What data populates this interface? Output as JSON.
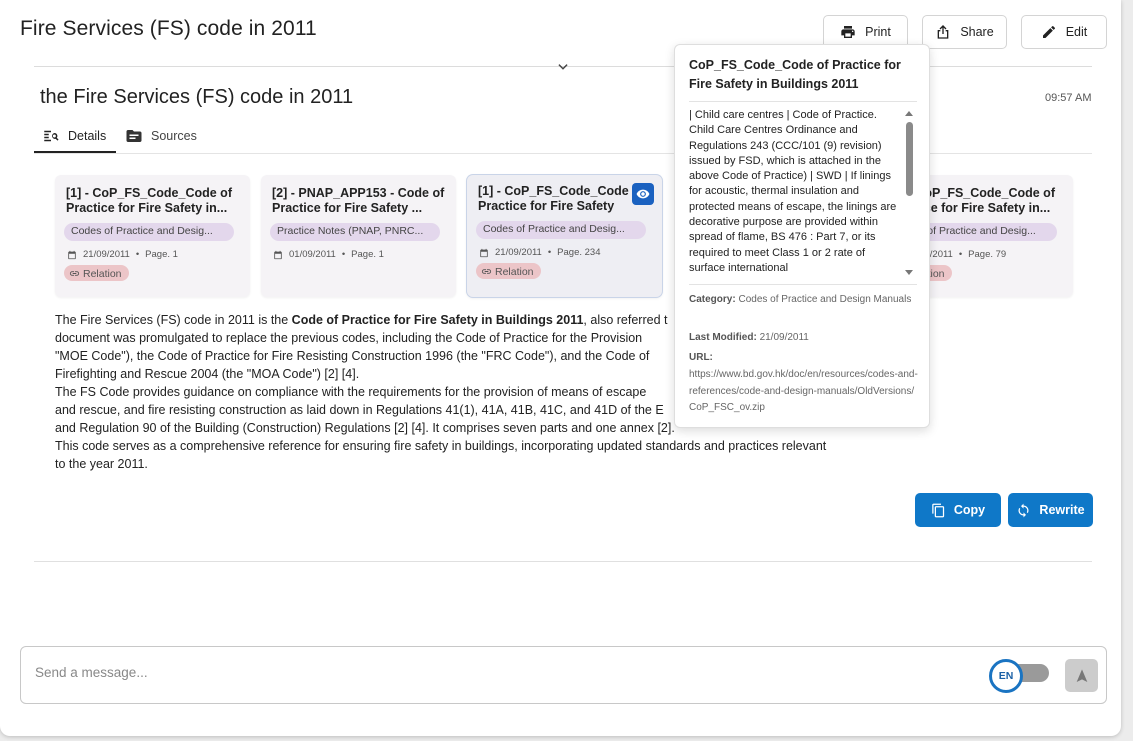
{
  "page_title": "Fire Services (FS) code in 2011",
  "header_buttons": {
    "print": "Print",
    "share": "Share",
    "edit": "Edit"
  },
  "answer": {
    "title": "the Fire Services (FS) code in 2011",
    "time": "09:57 AM",
    "tabs": [
      {
        "label": "Details",
        "icon": "details-search-icon"
      },
      {
        "label": "Sources",
        "icon": "folder-icon"
      }
    ]
  },
  "sources": [
    {
      "title": "[1] - CoP_FS_Code_Code of Practice for Fire Safety in...",
      "category": "Codes of Practice and Desig...",
      "date": "21/09/2011",
      "page": "Page. 1",
      "relation": "Relation"
    },
    {
      "title": "[2] - PNAP_APP153 - Code of Practice for Fire Safety ...",
      "category": "Practice Notes (PNAP, PNRC...",
      "date": "01/09/2011",
      "page": "Page. 1",
      "relation": ""
    },
    {
      "title": "[1] - CoP_FS_Code_Code Practice for Fire Safety in...",
      "category": "Codes of Practice and Desig...",
      "date": "21/09/2011",
      "page": "Page. 234",
      "relation": "Relation"
    },
    {
      "title": "[1] - CoP_FS_Code_Code of Practice for Fire Safety in...",
      "category": "Codes of Practice and Desig...",
      "date": "21/09/2011",
      "page": "Page. 79",
      "relation": "Relation"
    }
  ],
  "body": {
    "p1_a": "The Fire Services (FS) code in 2011 is the ",
    "p1_bold": "Code of Practice for Fire Safety in Buildings 2011",
    "p1_b": ", also referred t\ndocument was promulgated to replace the previous codes, including the Code of Practice for the Provision\n\"MOE Code\"), the Code of Practice for Fire Resisting Construction 1996 (the \"FRC Code\"), and the Code of\nFirefighting and Rescue 2004 (the \"MOA Code\") [2] [4].",
    "p2": "The FS Code provides guidance on compliance with the requirements for the provision of means of escape\nand rescue, and fire resisting construction as laid down in Regulations 41(1), 41A, 41B, 41C, and 41D of the E\nand Regulation 90 of the Building (Construction) Regulations [2] [4]. It comprises seven parts and one annex [2].",
    "p3": "This code serves as a comprehensive reference for ensuring fire safety in buildings, incorporating updated standards and practices relevant\nto the year 2011."
  },
  "actions": {
    "copy": "Copy",
    "rewrite": "Rewrite"
  },
  "composer": {
    "placeholder": "Send a message...",
    "language": "EN"
  },
  "popover": {
    "title": "CoP_FS_Code_Code of Practice for Fire Safety in Buildings 2011",
    "excerpt": "| Child care centres | Code of Practice. Child Care Centres Ordinance and Regulations 243 (CCC/101 (9) revision) issued by FSD, which is attached in the above Code of Practice) | SWD | If linings for acoustic, thermal insulation and protected means of escape, the linings are decorative purpose are provided within spread of flame, BS 476 : Part 7, or its required to meet Class 1 or 2 rate of surface international",
    "category_label": "Category:",
    "category": "Codes of Practice and Design Manuals",
    "modified_label": "Last Modified:",
    "modified": "21/09/2011",
    "url_label": "URL:",
    "url": "https://www.bd.gov.hk/doc/en/resources/codes-and-references/code-and-design-manuals/OldVersions/CoP_FSC_ov.zip"
  },
  "colors": {
    "primary": "#0f78c8",
    "category_chip": "#e3d7ec",
    "relation_chip": "#ecc5c8"
  }
}
